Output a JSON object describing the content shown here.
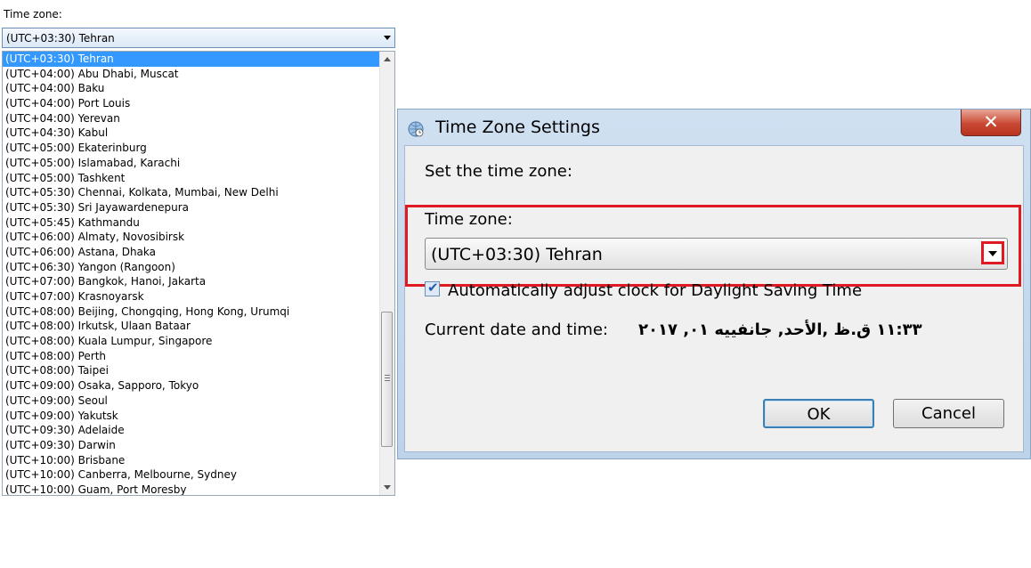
{
  "left_panel": {
    "label": "Time zone:",
    "selected_value": "(UTC+03:30) Tehran",
    "options": [
      "(UTC+03:30) Tehran",
      "(UTC+04:00) Abu Dhabi, Muscat",
      "(UTC+04:00) Baku",
      "(UTC+04:00) Port Louis",
      "(UTC+04:00) Yerevan",
      "(UTC+04:30) Kabul",
      "(UTC+05:00) Ekaterinburg",
      "(UTC+05:00) Islamabad, Karachi",
      "(UTC+05:00) Tashkent",
      "(UTC+05:30) Chennai, Kolkata, Mumbai, New Delhi",
      "(UTC+05:30) Sri Jayawardenepura",
      "(UTC+05:45) Kathmandu",
      "(UTC+06:00) Almaty, Novosibirsk",
      "(UTC+06:00) Astana, Dhaka",
      "(UTC+06:30) Yangon (Rangoon)",
      "(UTC+07:00) Bangkok, Hanoi, Jakarta",
      "(UTC+07:00) Krasnoyarsk",
      "(UTC+08:00) Beijing, Chongqing, Hong Kong, Urumqi",
      "(UTC+08:00) Irkutsk, Ulaan Bataar",
      "(UTC+08:00) Kuala Lumpur, Singapore",
      "(UTC+08:00) Perth",
      "(UTC+08:00) Taipei",
      "(UTC+09:00) Osaka, Sapporo, Tokyo",
      "(UTC+09:00) Seoul",
      "(UTC+09:00) Yakutsk",
      "(UTC+09:30) Adelaide",
      "(UTC+09:30) Darwin",
      "(UTC+10:00) Brisbane",
      "(UTC+10:00) Canberra, Melbourne, Sydney",
      "(UTC+10:00) Guam, Port Moresby"
    ],
    "selected_index": 0
  },
  "dialog": {
    "title": "Time Zone Settings",
    "close_icon": "✕",
    "set_label": "Set the time zone:",
    "tz_label": "Time zone:",
    "tz_value": "(UTC+03:30) Tehran",
    "dst_checked": true,
    "dst_label": "Automatically adjust clock for Daylight Saving Time",
    "current_label": "Current date and time:",
    "current_value": "١١:٣٣ ق.ظ ,الأحد, جانفييه ٠١, ٢٠١٧",
    "ok_label": "OK",
    "cancel_label": "Cancel"
  },
  "colors": {
    "highlight_red": "#e01a22",
    "selection_blue": "#3399ff",
    "titlebar_blue": "#cfe0f1"
  }
}
